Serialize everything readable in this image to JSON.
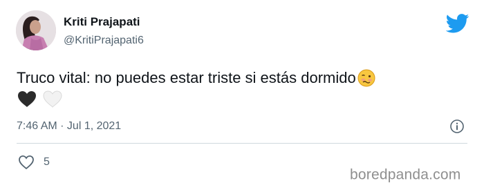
{
  "author": {
    "display_name": "Kriti Prajapati",
    "handle": "@KritiPrajapati6"
  },
  "tweet": {
    "text": "Truco vital: no puedes estar triste si estás dormido",
    "timestamp": "7:46 AM · Jul 1, 2021",
    "likes": "5"
  },
  "watermark": "boredpanda.com",
  "icons": {
    "brand": "twitter-bird-icon",
    "emoji": "woozy-face-emoji",
    "hearts": [
      "black-heart-emoji",
      "white-heart-emoji"
    ],
    "info": "info-icon",
    "like": "heart-outline-icon"
  },
  "colors": {
    "twitter_blue": "#1d9bf0",
    "text_primary": "#0f1419",
    "text_secondary": "#536471",
    "divider": "#cfd9de"
  }
}
